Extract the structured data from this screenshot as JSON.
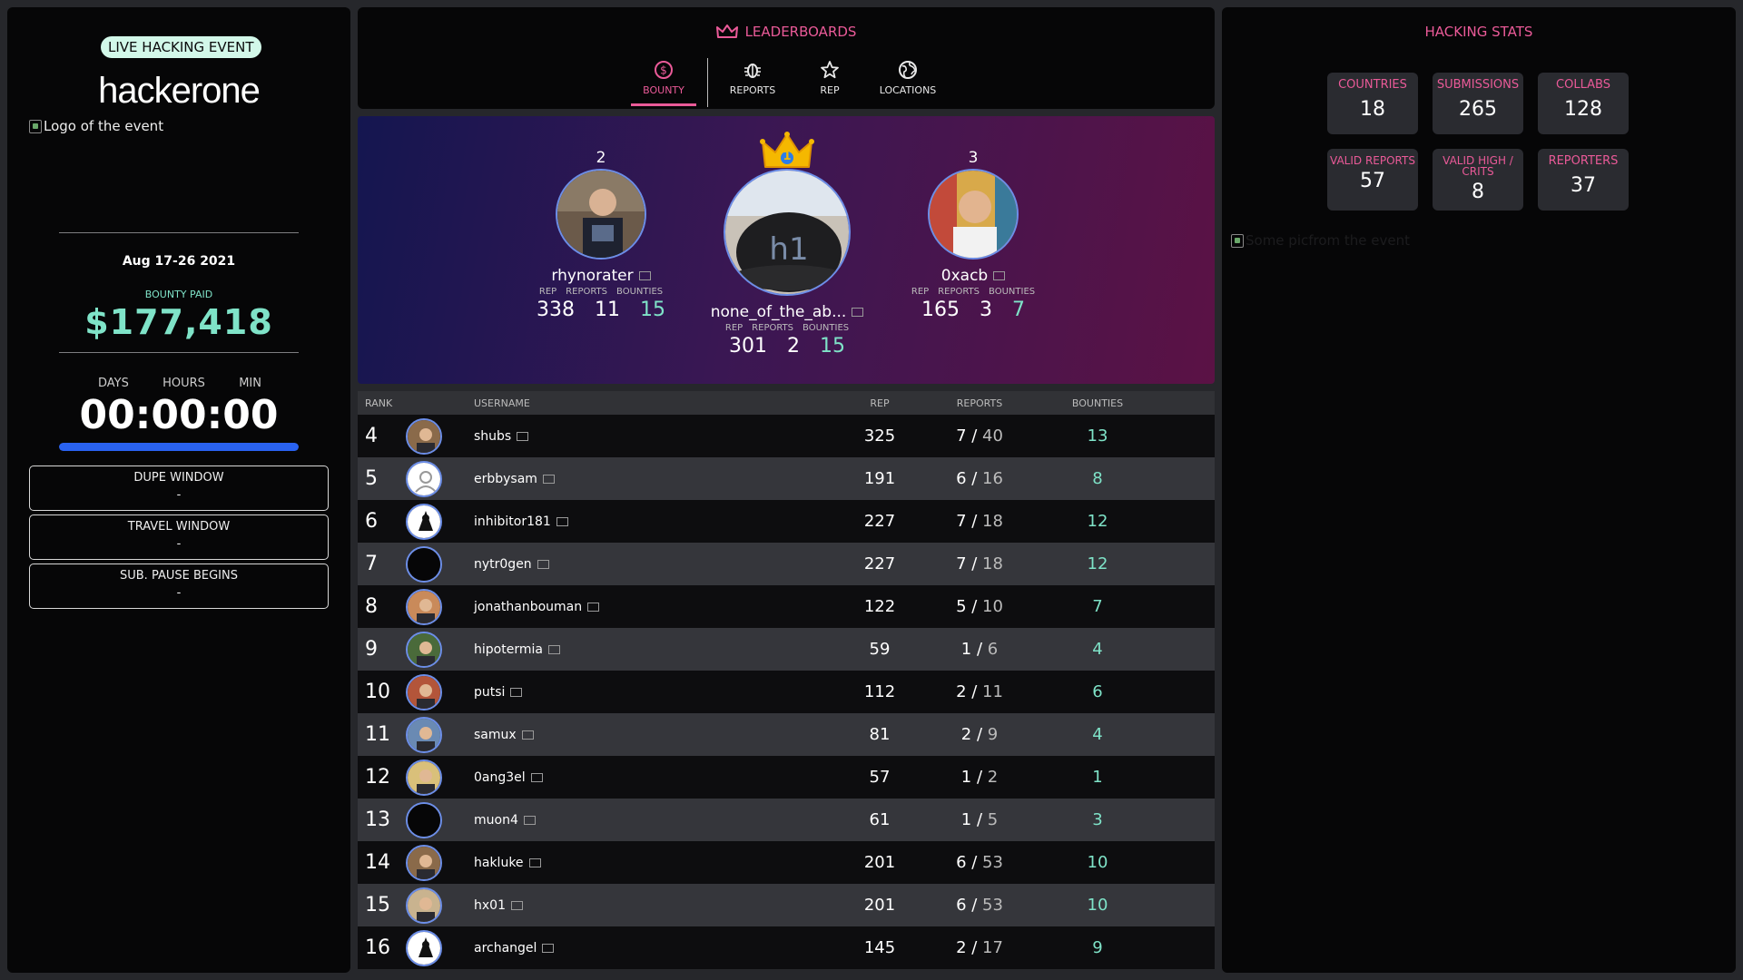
{
  "event": {
    "badge": "LIVE HACKING EVENT",
    "brand": "hackerone",
    "logo_alt": "Logo of the event",
    "dates": "Aug 17-26 2021",
    "bounty_label": "BOUNTY PAID",
    "bounty_amount": "$177,418",
    "countdown": {
      "labels": [
        "DAYS",
        "HOURS",
        "MIN"
      ],
      "time": "00:00:00",
      "progress_percent": 100
    },
    "windows": [
      {
        "title": "DUPE WINDOW",
        "value": "-"
      },
      {
        "title": "TRAVEL WINDOW",
        "value": "-"
      },
      {
        "title": "SUB. PAUSE BEGINS",
        "value": "-"
      }
    ]
  },
  "leaderboards": {
    "title": "LEADERBOARDS",
    "tabs": [
      {
        "label": "BOUNTY",
        "icon": "dollar-circle-icon",
        "active": true
      },
      {
        "label": "REPORTS",
        "icon": "bug-icon",
        "active": false
      },
      {
        "label": "REP",
        "icon": "star-icon",
        "active": false
      },
      {
        "label": "LOCATIONS",
        "icon": "globe-icon",
        "active": false
      }
    ]
  },
  "podium": {
    "headers": {
      "rep": "REP",
      "reports": "REPORTS",
      "bounties": "BOUNTIES"
    },
    "first": {
      "rank": "1",
      "username": "none_of_the_ab...",
      "rep": "301",
      "reports": "2",
      "bounties": "15"
    },
    "second": {
      "rank": "2",
      "username": "rhynorater",
      "rep": "338",
      "reports": "11",
      "bounties": "15"
    },
    "third": {
      "rank": "3",
      "username": "0xacb",
      "rep": "165",
      "reports": "3",
      "bounties": "7"
    }
  },
  "table": {
    "headers": {
      "rank": "RANK",
      "username": "USERNAME",
      "rep": "REP",
      "reports": "REPORTS",
      "bounties": "BOUNTIES"
    },
    "rows": [
      {
        "rank": "4",
        "username": "shubs",
        "rep": "325",
        "reports_valid": "7",
        "reports_total": "40",
        "bounties": "13",
        "avatar": "photo"
      },
      {
        "rank": "5",
        "username": "erbbysam",
        "rep": "191",
        "reports_valid": "6",
        "reports_total": "16",
        "bounties": "8",
        "avatar": "default"
      },
      {
        "rank": "6",
        "username": "inhibitor181",
        "rep": "227",
        "reports_valid": "7",
        "reports_total": "18",
        "bounties": "12",
        "avatar": "logo"
      },
      {
        "rank": "7",
        "username": "nytr0gen",
        "rep": "227",
        "reports_valid": "7",
        "reports_total": "18",
        "bounties": "12",
        "avatar": "empty"
      },
      {
        "rank": "8",
        "username": "jonathanbouman",
        "rep": "122",
        "reports_valid": "5",
        "reports_total": "10",
        "bounties": "7",
        "avatar": "photo"
      },
      {
        "rank": "9",
        "username": "hipotermia",
        "rep": "59",
        "reports_valid": "1",
        "reports_total": "6",
        "bounties": "4",
        "avatar": "photo"
      },
      {
        "rank": "10",
        "username": "putsi",
        "rep": "112",
        "reports_valid": "2",
        "reports_total": "11",
        "bounties": "6",
        "avatar": "photo"
      },
      {
        "rank": "11",
        "username": "samux",
        "rep": "81",
        "reports_valid": "2",
        "reports_total": "9",
        "bounties": "4",
        "avatar": "photo"
      },
      {
        "rank": "12",
        "username": "0ang3el",
        "rep": "57",
        "reports_valid": "1",
        "reports_total": "2",
        "bounties": "1",
        "avatar": "photo"
      },
      {
        "rank": "13",
        "username": "muon4",
        "rep": "61",
        "reports_valid": "1",
        "reports_total": "5",
        "bounties": "3",
        "avatar": "empty"
      },
      {
        "rank": "14",
        "username": "hakluke",
        "rep": "201",
        "reports_valid": "6",
        "reports_total": "53",
        "bounties": "10",
        "avatar": "photo"
      },
      {
        "rank": "15",
        "username": "hx01",
        "rep": "201",
        "reports_valid": "6",
        "reports_total": "53",
        "bounties": "10",
        "avatar": "photo"
      },
      {
        "rank": "16",
        "username": "archangel",
        "rep": "145",
        "reports_valid": "2",
        "reports_total": "17",
        "bounties": "9",
        "avatar": "logo"
      }
    ]
  },
  "stats": {
    "title": "HACKING STATS",
    "items": [
      {
        "label": "COUNTRIES",
        "value": "18"
      },
      {
        "label": "SUBMISSIONS",
        "value": "265"
      },
      {
        "label": "COLLABS",
        "value": "128"
      },
      {
        "label": "VALID REPORTS",
        "value": "57"
      },
      {
        "label": "VALID HIGH / CRITS",
        "value": "8"
      },
      {
        "label": "REPORTERS",
        "value": "37"
      }
    ],
    "event_pic_alt": "Some picfrom the event"
  },
  "colors": {
    "accent_pink": "#ea5a98",
    "accent_mint": "#7fe3c8",
    "progress_blue": "#2962f0"
  }
}
